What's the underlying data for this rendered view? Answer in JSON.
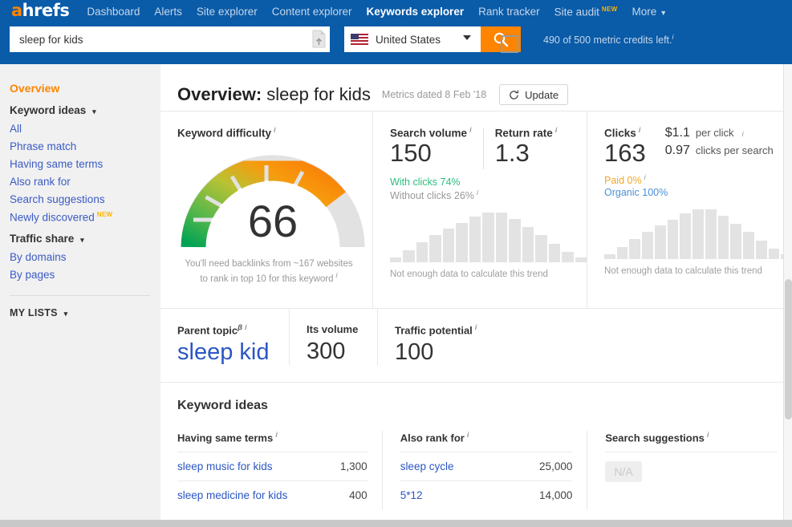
{
  "topnav": {
    "logo_a": "a",
    "logo_rest": "hrefs",
    "items": [
      {
        "label": "Dashboard",
        "active": false
      },
      {
        "label": "Alerts",
        "active": false
      },
      {
        "label": "Site explorer",
        "active": false
      },
      {
        "label": "Content explorer",
        "active": false
      },
      {
        "label": "Keywords explorer",
        "active": true
      },
      {
        "label": "Rank tracker",
        "active": false
      },
      {
        "label": "Site audit",
        "active": false,
        "badge": "NEW"
      },
      {
        "label": "More",
        "active": false,
        "caret": "▼"
      }
    ]
  },
  "search": {
    "value": "sleep for kids",
    "placeholder": "Enter keyword",
    "country": "United States",
    "credits": "490 of 500 metric credits left."
  },
  "sidebar": {
    "overview": "Overview",
    "keyword_ideas_head": "Keyword ideas",
    "keyword_ideas": [
      "All",
      "Phrase match",
      "Having same terms",
      "Also rank for",
      "Search suggestions",
      "Newly discovered"
    ],
    "newly_discovered_badge": "NEW",
    "traffic_share_head": "Traffic share",
    "traffic_share": [
      "By domains",
      "By pages"
    ],
    "my_lists": "MY LISTS"
  },
  "page": {
    "title_prefix": "Overview:",
    "keyword": "sleep for kids",
    "metrics_date": "Metrics dated 8 Feb '18",
    "update_label": "Update"
  },
  "keyword_difficulty": {
    "label": "Keyword difficulty",
    "value": "66",
    "note_line1": "You'll need backlinks from ~167 websites",
    "note_line2": "to rank in top 10 for this keyword"
  },
  "search_volume": {
    "label": "Search volume",
    "value": "150",
    "return_rate_label": "Return rate",
    "return_rate_value": "1.3",
    "with_clicks": "With clicks 74%",
    "without_clicks": "Without clicks 26%",
    "trend_note": "Not enough data to calculate this trend"
  },
  "clicks": {
    "label": "Clicks",
    "value": "163",
    "cpc_value": "$1.1",
    "cpc_label": "per click",
    "cps_value": "0.97",
    "cps_label": "clicks per search",
    "paid": "Paid 0%",
    "organic": "Organic 100%",
    "trend_note": "Not enough data to calculate this trend"
  },
  "parent_topic": {
    "label": "Parent topic",
    "beta": "β",
    "value": "sleep kid",
    "its_volume_label": "Its volume",
    "its_volume_value": "300",
    "traffic_potential_label": "Traffic potential",
    "traffic_potential_value": "100"
  },
  "keyword_ideas": {
    "title": "Keyword ideas",
    "columns": [
      {
        "head": "Having same terms",
        "rows": [
          {
            "kw": "sleep music for kids",
            "vol": "1,300"
          },
          {
            "kw": "sleep medicine for kids",
            "vol": "400"
          }
        ]
      },
      {
        "head": "Also rank for",
        "rows": [
          {
            "kw": "sleep cycle",
            "vol": "25,000"
          },
          {
            "kw": "5*12",
            "vol": "14,000"
          }
        ]
      },
      {
        "head": "Search suggestions",
        "na": "N/A",
        "rows": []
      }
    ]
  },
  "colors": {
    "brand_blue": "#0a5ba8",
    "accent_orange": "#ff8400",
    "link_blue": "#2b56c4",
    "green": "#2bbd7e",
    "gauge_green": "#00a354",
    "gauge_orange": "#f97c08"
  },
  "chart_data": [
    {
      "type": "gauge",
      "title": "Keyword difficulty",
      "value": 66,
      "min": 0,
      "max": 100,
      "filled_fraction": 0.66,
      "segment_colors": [
        "#00a354",
        "#5cb84a",
        "#a8bf3c",
        "#d9a82a",
        "#f97c08"
      ],
      "track_color": "#e2e2e2"
    },
    {
      "type": "bar",
      "title": "Search volume trend",
      "categories": [
        "1",
        "2",
        "3",
        "4",
        "5",
        "6",
        "7",
        "8",
        "9",
        "10",
        "11",
        "12",
        "13"
      ],
      "values": [
        10,
        25,
        40,
        55,
        68,
        80,
        92,
        100,
        100,
        88,
        72,
        55,
        38,
        22,
        10
      ],
      "xlabel": "",
      "ylabel": "",
      "ylim": [
        0,
        100
      ],
      "grid": false,
      "note": "Not enough data to calculate this trend",
      "bar_color": "#e3e3e3"
    },
    {
      "type": "bar",
      "title": "Clicks trend",
      "categories": [
        "1",
        "2",
        "3",
        "4",
        "5",
        "6",
        "7",
        "8",
        "9",
        "10",
        "11",
        "12",
        "13"
      ],
      "values": [
        10,
        25,
        40,
        55,
        68,
        80,
        92,
        100,
        100,
        88,
        72,
        55,
        38,
        22,
        10
      ],
      "xlabel": "",
      "ylabel": "",
      "ylim": [
        0,
        100
      ],
      "grid": false,
      "note": "Not enough data to calculate this trend",
      "bar_color": "#e3e3e3"
    }
  ]
}
